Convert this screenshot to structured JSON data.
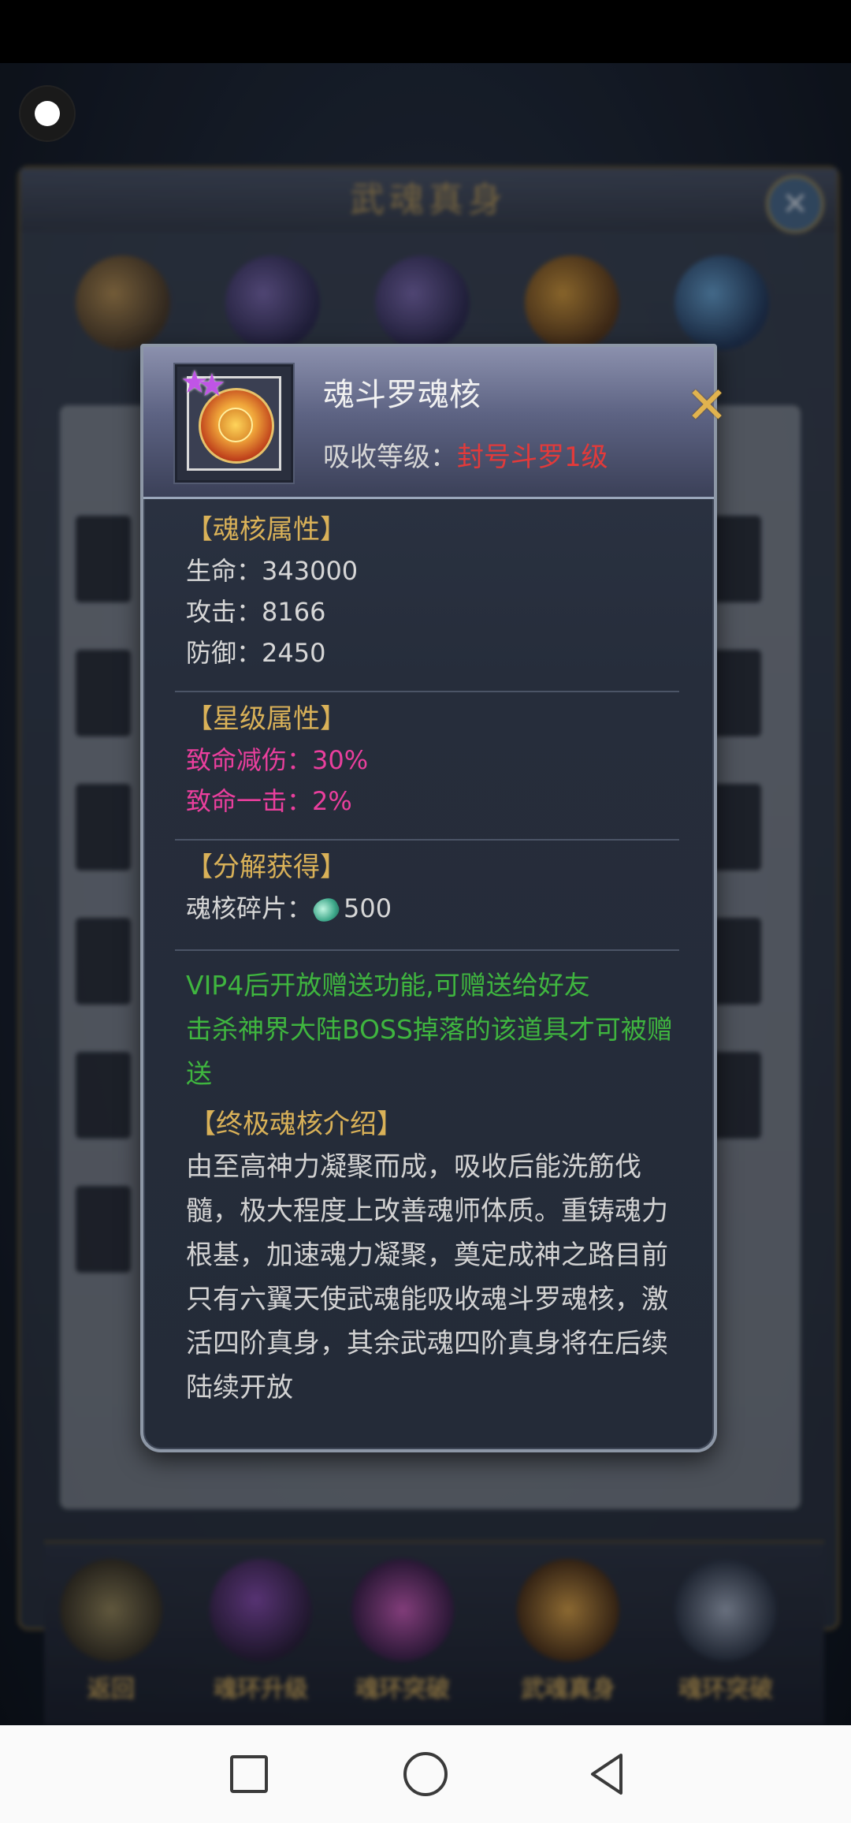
{
  "background": {
    "window_title": "武魂真身",
    "bottom_buttons": [
      "返回",
      "",
      "魂环升级",
      "魂环突破",
      "武魂真身",
      "魂环突破"
    ]
  },
  "popup": {
    "item_name": "魂斗罗魂核",
    "absorb_label": "吸收等级：",
    "absorb_value": "封号斗罗1级",
    "sections": {
      "core_attrs": {
        "title": "【魂核属性】",
        "rows": [
          "生命：343000",
          "攻击：8166",
          "防御：2450"
        ]
      },
      "star_attrs": {
        "title": "【星级属性】",
        "rows": [
          "致命减伤：30%",
          "致命一击：2%"
        ]
      },
      "decompose": {
        "title": "【分解获得】",
        "label": "魂核碎片：",
        "value": "500"
      },
      "notice": {
        "line1": "VIP4后开放赠送功能,可赠送给好友",
        "line2": "击杀神界大陆BOSS掉落的该道具才可被赠送"
      },
      "intro": {
        "title": "【终极魂核介绍】",
        "text": "由至高神力凝聚而成，吸收后能洗筋伐髓，极大程度上改善魂师体质。重铸魂力根基，加速魂力凝聚，奠定成神之路目前只有六翼天使武魂能吸收魂斗罗魂核，激活四阶真身，其余武魂四阶真身将在后续陆续开放"
      }
    },
    "colors": {
      "section_title": "#d9b158",
      "star_attr": "#ea3f9d",
      "absorb_value": "#e33a3a",
      "notice": "#3fb53f"
    }
  },
  "icons": {
    "close": "close-icon",
    "star": "star-icon",
    "shard": "soul-core-shard-icon"
  }
}
